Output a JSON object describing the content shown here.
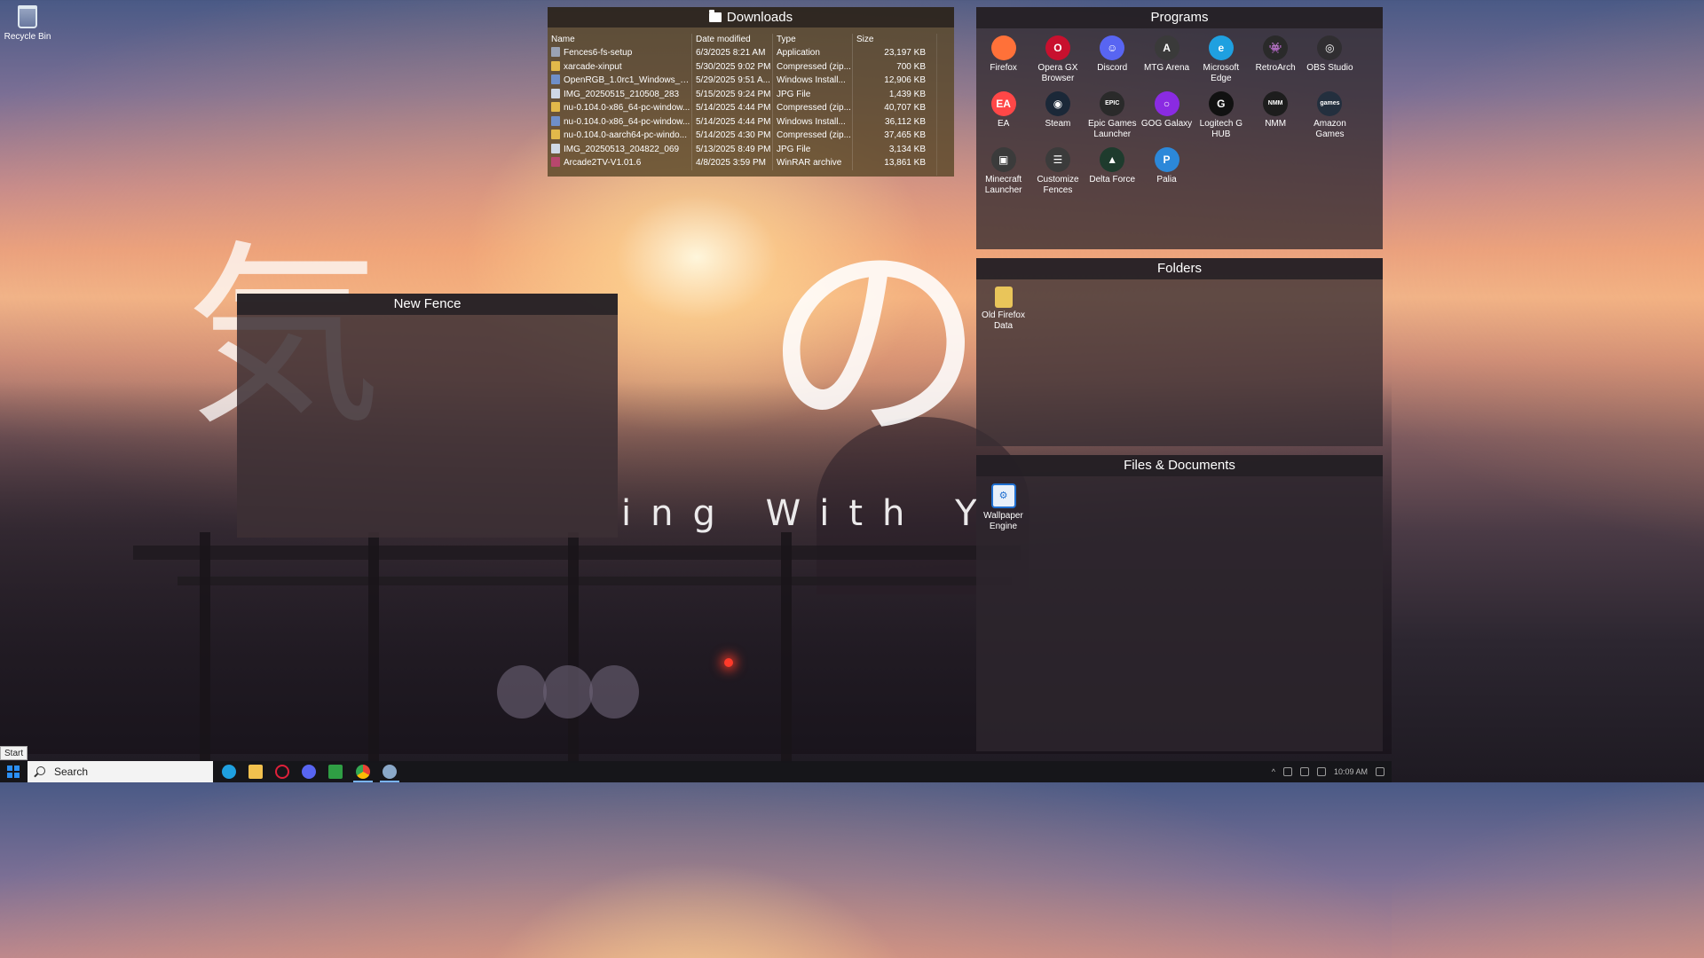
{
  "desktop": {
    "recycle_bin_label": "Recycle Bin",
    "wallpaper_subtitle": "ing With Y",
    "wallpaper_kana_large": "の",
    "wallpaper_kana_small": "気"
  },
  "downloads": {
    "title": "Downloads",
    "columns": [
      "Name",
      "Date modified",
      "Type",
      "Size"
    ],
    "rows": [
      {
        "name": "Fences6-fs-setup",
        "date": "6/3/2025 8:21 AM",
        "type": "Application",
        "size": "23,197 KB",
        "icon": "app"
      },
      {
        "name": "xarcade-xinput",
        "date": "5/30/2025 9:02 PM",
        "type": "Compressed (zip...",
        "size": "700 KB",
        "icon": "zip"
      },
      {
        "name": "OpenRGB_1.0rc1_Windows_64...",
        "date": "5/29/2025 9:51 A...",
        "type": "Windows Install...",
        "size": "12,906 KB",
        "icon": "msi"
      },
      {
        "name": "IMG_20250515_210508_283",
        "date": "5/15/2025 9:24 PM",
        "type": "JPG File",
        "size": "1,439 KB",
        "icon": "jpg"
      },
      {
        "name": "nu-0.104.0-x86_64-pc-window...",
        "date": "5/14/2025 4:44 PM",
        "type": "Compressed (zip...",
        "size": "40,707 KB",
        "icon": "zip"
      },
      {
        "name": "nu-0.104.0-x86_64-pc-window...",
        "date": "5/14/2025 4:44 PM",
        "type": "Windows Install...",
        "size": "36,112 KB",
        "icon": "msi"
      },
      {
        "name": "nu-0.104.0-aarch64-pc-windo...",
        "date": "5/14/2025 4:30 PM",
        "type": "Compressed (zip...",
        "size": "37,465 KB",
        "icon": "zip"
      },
      {
        "name": "IMG_20250513_204822_069",
        "date": "5/13/2025 8:49 PM",
        "type": "JPG File",
        "size": "3,134 KB",
        "icon": "jpg"
      },
      {
        "name": "Arcade2TV-V1.01.6",
        "date": "4/8/2025 3:59 PM",
        "type": "WinRAR archive",
        "size": "13,861 KB",
        "icon": "rar"
      }
    ]
  },
  "programs": {
    "title": "Programs",
    "items": [
      {
        "label": "Firefox",
        "glyph": "",
        "color": "#ff7139",
        "name": "firefox-icon"
      },
      {
        "label": "Opera GX Browser",
        "glyph": "O",
        "color": "#c8102e",
        "name": "opera-gx-icon"
      },
      {
        "label": "Discord",
        "glyph": "☺",
        "color": "#5865f2",
        "name": "discord-icon"
      },
      {
        "label": "MTG Arena",
        "glyph": "A",
        "color": "#3a3a3a",
        "name": "mtg-arena-icon"
      },
      {
        "label": "Microsoft Edge",
        "glyph": "e",
        "color": "#1fa0e0",
        "name": "edge-icon"
      },
      {
        "label": "RetroArch",
        "glyph": "👾",
        "color": "#2a2a2a",
        "name": "retroarch-icon"
      },
      {
        "label": "OBS Studio",
        "glyph": "◎",
        "color": "#302e31",
        "name": "obs-studio-icon"
      },
      {
        "label": "EA",
        "glyph": "EA",
        "color": "#ff4747",
        "name": "ea-icon"
      },
      {
        "label": "Steam",
        "glyph": "◉",
        "color": "#1b2838",
        "name": "steam-icon"
      },
      {
        "label": "Epic Games Launcher",
        "glyph": "EPIC",
        "color": "#2a2a2a",
        "name": "epic-games-icon"
      },
      {
        "label": "GOG Galaxy",
        "glyph": "○",
        "color": "#8a2be2",
        "name": "gog-galaxy-icon"
      },
      {
        "label": "Logitech G HUB",
        "glyph": "G",
        "color": "#111111",
        "name": "logitech-ghub-icon"
      },
      {
        "label": "NMM",
        "glyph": "NMM",
        "color": "#1d1d1d",
        "name": "nmm-icon"
      },
      {
        "label": "Amazon Games",
        "glyph": "games",
        "color": "#232f3e",
        "name": "amazon-games-icon"
      },
      {
        "label": "Minecraft Launcher",
        "glyph": "▣",
        "color": "#3b3b3b",
        "name": "minecraft-launcher-icon"
      },
      {
        "label": "Customize Fences",
        "glyph": "☰",
        "color": "#3b3b3b",
        "name": "customize-fences-icon"
      },
      {
        "label": "Delta Force",
        "glyph": "▲",
        "color": "#1e3b2d",
        "name": "delta-force-icon"
      },
      {
        "label": "Palia",
        "glyph": "P",
        "color": "#2c88d9",
        "name": "palia-icon"
      }
    ]
  },
  "folders": {
    "title": "Folders",
    "items": [
      {
        "label": "Old Firefox Data"
      }
    ]
  },
  "files": {
    "title": "Files & Documents",
    "items": [
      {
        "label": "Wallpaper Engine"
      }
    ]
  },
  "new_fence": {
    "title": "New Fence"
  },
  "taskbar": {
    "start_tooltip": "Start",
    "search_placeholder": "Search",
    "clock": "10:09 AM"
  },
  "colors": {
    "accent": "#2b8ff5",
    "downloads_fence_bg": "#5a4828",
    "fence_title_bg": "#231e23"
  }
}
